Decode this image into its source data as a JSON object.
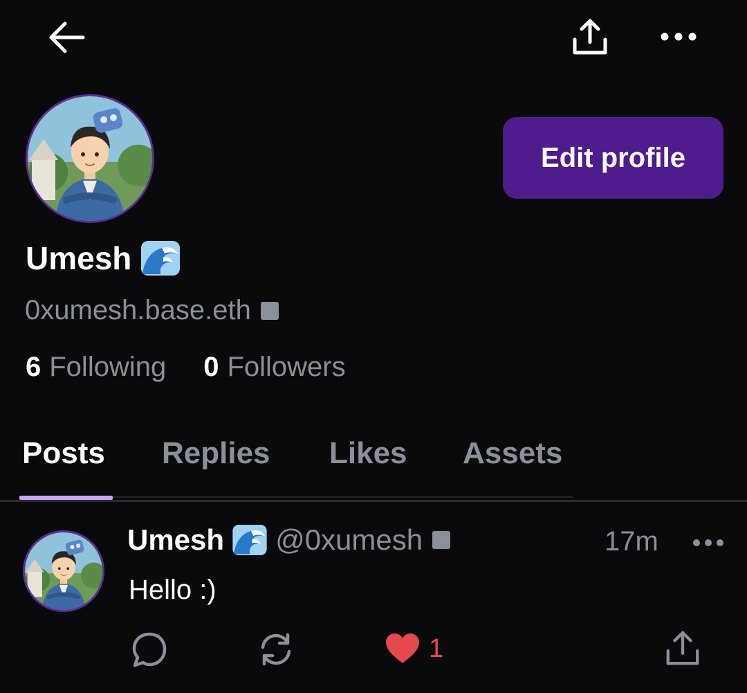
{
  "topbar": {
    "back_icon": "arrow-left-icon",
    "share_icon": "share-icon",
    "more_icon": "more-horizontal-icon"
  },
  "profile": {
    "display_name": "Umesh",
    "name_emoji": "wave-emoji",
    "handle": "0xumesh.base.eth",
    "edit_button_label": "Edit profile",
    "following_count": "6",
    "following_label": "Following",
    "followers_count": "0",
    "followers_label": "Followers"
  },
  "tabs": [
    {
      "label": "Posts",
      "active": true
    },
    {
      "label": "Replies",
      "active": false
    },
    {
      "label": "Likes",
      "active": false
    },
    {
      "label": "Assets",
      "active": false
    }
  ],
  "post": {
    "author_name": "Umesh",
    "author_handle": "@0xumesh",
    "time": "17m",
    "text": "Hello :)",
    "like_count": "1",
    "liked": true
  },
  "colors": {
    "background": "#0a0a0c",
    "accent": "#4e1c8c",
    "tab_indicator": "#c9a6f5",
    "muted_text": "#8b8f99",
    "like_red": "#e5484d"
  }
}
